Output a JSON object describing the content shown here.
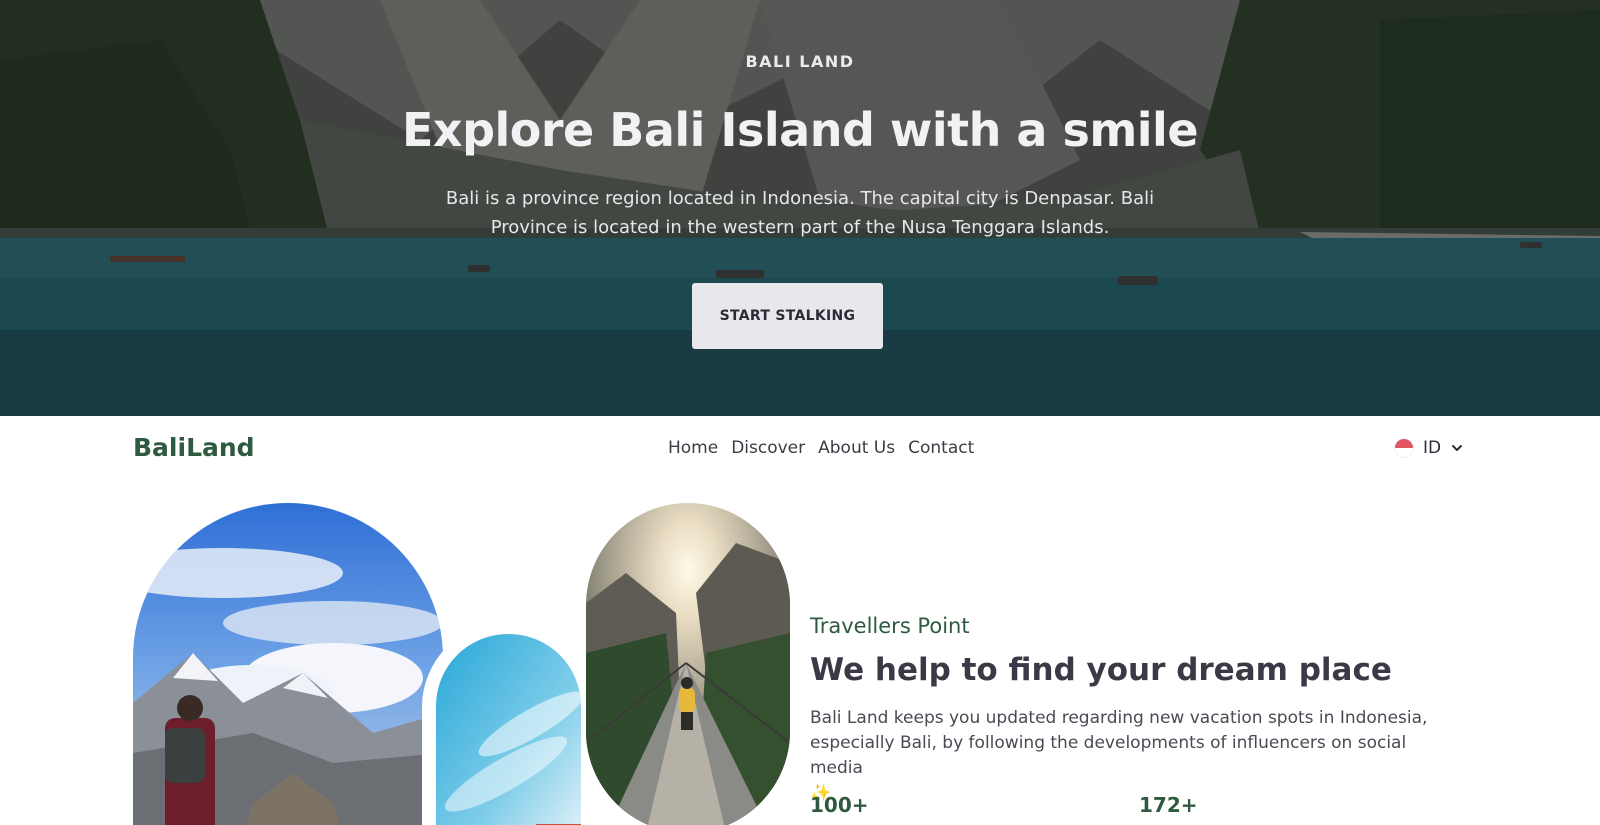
{
  "hero": {
    "eyebrow": "BALI LAND",
    "title": "Explore Bali Island with a smile",
    "description": "Bali is a province region located in Indonesia. The capital city is Denpasar. Bali Province is located in the western part of the Nusa Tenggara Islands.",
    "cta_label": "START STALKING",
    "background_image": "mountain-lake-photo"
  },
  "navbar": {
    "brand": "BaliLand",
    "links": [
      {
        "label": "Home"
      },
      {
        "label": "Discover"
      },
      {
        "label": "About Us"
      },
      {
        "label": "Contact"
      }
    ],
    "language": {
      "code": "ID",
      "flag": "indonesia-flag-icon",
      "dropdown_icon": "chevron-down-icon"
    }
  },
  "gallery": {
    "images": [
      "hiker-mountain-photo",
      "sky-photo",
      "suspension-bridge-photo"
    ]
  },
  "info": {
    "eyebrow": "Travellers Point",
    "title": "We help to find your dream place",
    "description": "Bali Land keeps you updated regarding new vacation spots in Indonesia, especially Bali, by following the developments of influencers on social media",
    "emoji": "✨",
    "stats": [
      {
        "value": "100+"
      },
      {
        "value": "172+"
      }
    ]
  },
  "colors": {
    "brand": "#2e5a3f",
    "text_dark": "#3b3945",
    "cta_bg": "#e8e8ec",
    "flag_red": "#e25563"
  }
}
